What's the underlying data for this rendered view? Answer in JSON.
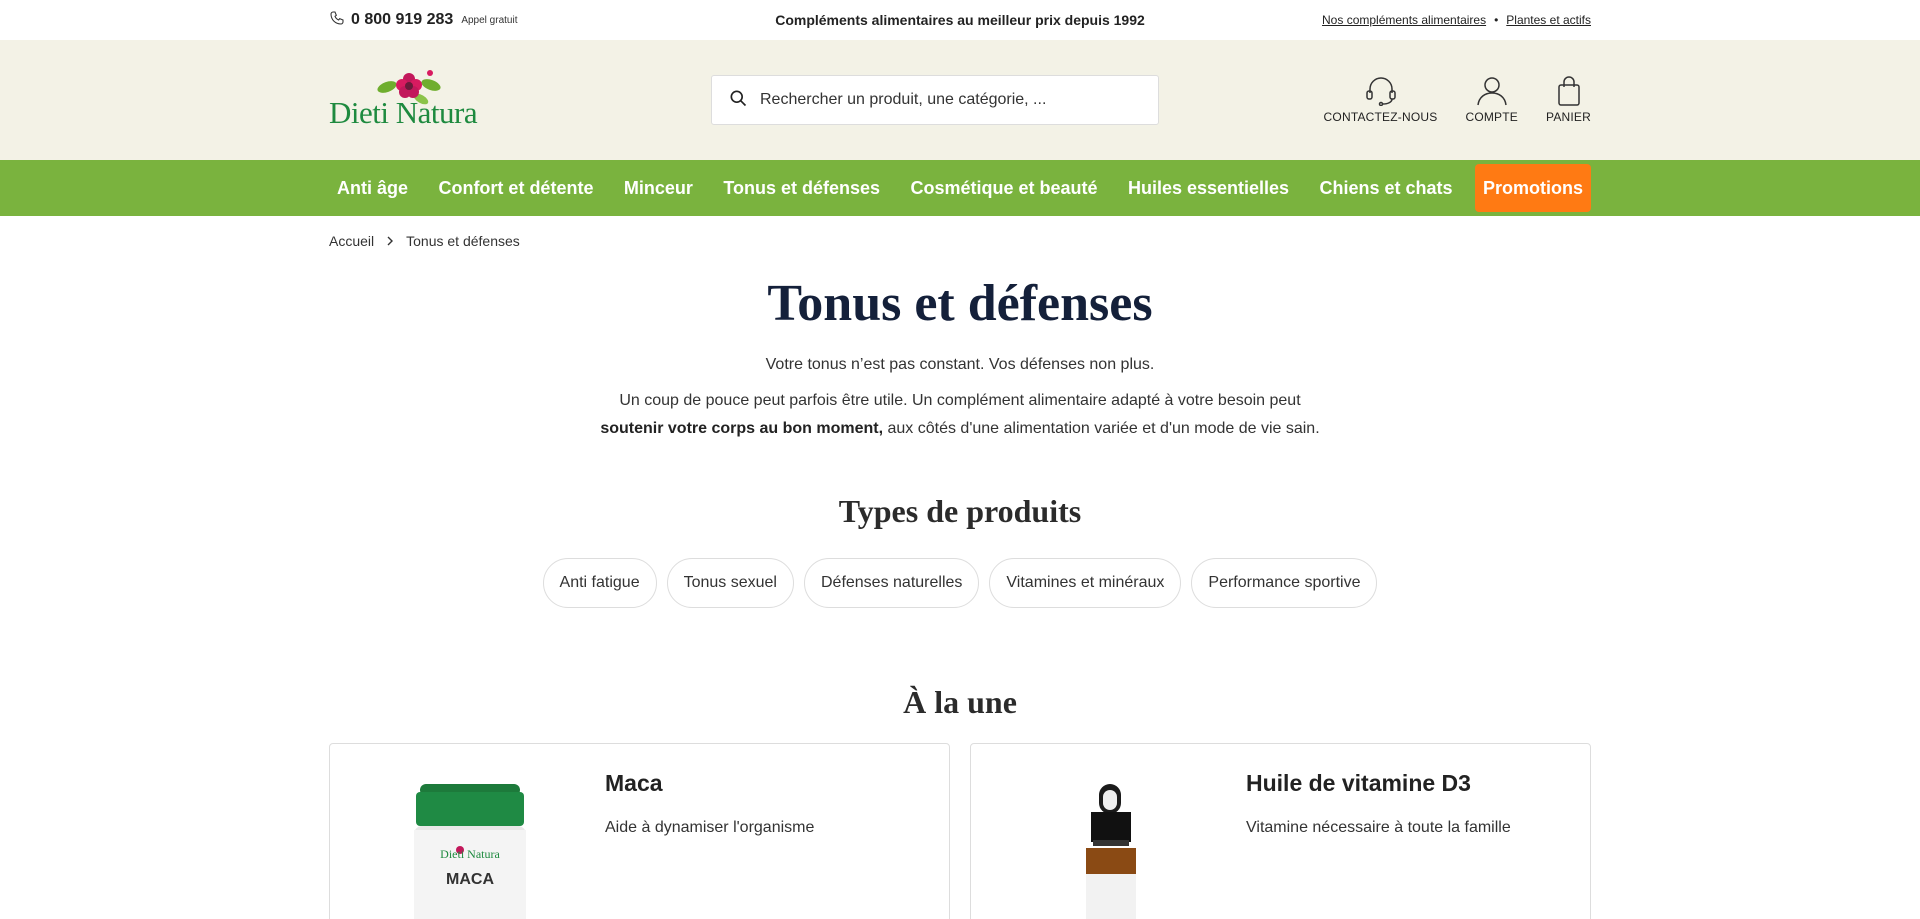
{
  "topbar": {
    "phone": "0 800 919 283",
    "phone_note": "Appel gratuit",
    "tagline": "Compléments alimentaires au meilleur prix depuis 1992",
    "links": [
      "Nos compléments alimentaires",
      "Plantes et actifs"
    ]
  },
  "header": {
    "logo_text_1": "Dieti",
    "logo_text_2": "Natura",
    "search_placeholder": "Rechercher un produit, une catégorie, ...",
    "actions": [
      "CONTACTEZ-NOUS",
      "COMPTE",
      "PANIER"
    ]
  },
  "nav": {
    "items": [
      "Anti âge",
      "Confort et détente",
      "Minceur",
      "Tonus et défenses",
      "Cosmétique et beauté",
      "Huiles essentielles",
      "Chiens et chats"
    ],
    "promo": "Promotions"
  },
  "breadcrumb": [
    "Accueil",
    "Tonus et défenses"
  ],
  "page": {
    "title": "Tonus et défenses",
    "intro_1": "Votre tonus n’est pas constant. Vos défenses non plus.",
    "intro_2": "Un coup de pouce peut parfois être utile. Un complément alimentaire adapté à votre besoin peut",
    "intro_3_bold": "soutenir votre corps au bon moment,",
    "intro_3_rest": " aux côtés d'une alimentation variée et d'un mode de vie sain."
  },
  "types": {
    "title": "Types de produits",
    "chips": [
      "Anti fatigue",
      "Tonus sexuel",
      "Défenses naturelles",
      "Vitamines et minéraux",
      "Performance sportive"
    ]
  },
  "featured": {
    "title": "À la une",
    "products": [
      {
        "name": "Maca",
        "desc": "Aide à dynamiser l'organisme",
        "label_brand": "Dieti Natura",
        "label_name": "MACA"
      },
      {
        "name": "Huile de vitamine D3",
        "desc": "Vitamine nécessaire à toute la famille"
      }
    ]
  },
  "colors": {
    "nav_green": "#7ab33e",
    "promo_orange": "#ff7a13",
    "header_bg": "#f3f2e6",
    "logo_green": "#1e8a3f",
    "title_navy": "#14203a"
  }
}
